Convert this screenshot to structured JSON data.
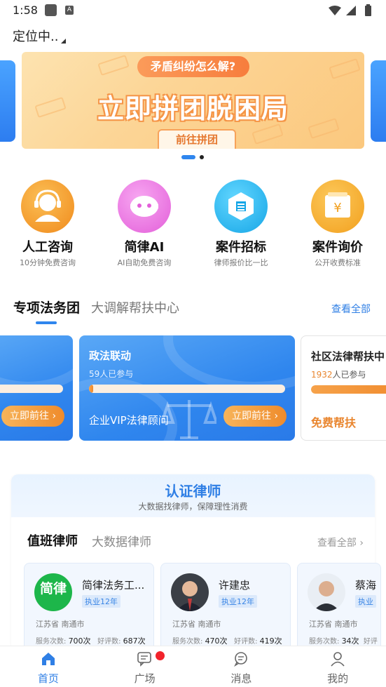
{
  "status": {
    "time": "1:58",
    "a_icon": "A"
  },
  "location": {
    "label": "定位中.."
  },
  "banner": {
    "subtitle": "矛盾纠纷怎么解?",
    "headline": "立即拼团脱困局",
    "cta": "前往拼团",
    "accent": "#f59547"
  },
  "quick_actions": [
    {
      "title": "人工咨询",
      "subtitle": "10分钟免费咨询",
      "icon": "headset-icon",
      "color": "#f39a2b"
    },
    {
      "title": "简律AI",
      "subtitle": "AI自助免费咨询",
      "icon": "ai-robot-icon",
      "color": "#ec6fe0"
    },
    {
      "title": "案件招标",
      "subtitle": "律师报价比一比",
      "icon": "cube-icon",
      "color": "#24b8ee"
    },
    {
      "title": "案件询价",
      "subtitle": "公开收费标准",
      "icon": "yuan-box-icon",
      "color": "#f5a92e"
    }
  ],
  "section": {
    "tab_active": "专项法务团",
    "tab_inactive": "大调解帮扶中心",
    "view_all": "查看全部"
  },
  "group_cards": [
    {
      "go": "立即前往",
      "progress": 1.0
    },
    {
      "title": "政法联动",
      "count": "59人已参与",
      "progress": 0.02,
      "go": "立即前往",
      "footer": "企业VIP法律顾问"
    },
    {
      "title": "社区法律帮扶中",
      "count_num": "1932",
      "count_suffix": "人已参与",
      "footer": "免费帮扶",
      "progress": 1.0
    }
  ],
  "cert": {
    "title": "认证律师",
    "subtitle": "大数据找律师，保障理性消费",
    "tab_active": "值班律师",
    "tab_inactive": "大数据律师",
    "view_all": "查看全部"
  },
  "lawyers": [
    {
      "name": "简律法务工...",
      "years": "执业12年",
      "area": "江苏省  南通市",
      "svc_label": "服务次数:",
      "svc": "700次",
      "rev_label": "好评数:",
      "rev": "687次",
      "logo_text": "简律"
    },
    {
      "name": "许建忠",
      "years": "执业12年",
      "area": "江苏省  南通市",
      "svc_label": "服务次数:",
      "svc": "470次",
      "rev_label": "好评数:",
      "rev": "419次"
    },
    {
      "name": "蔡海",
      "years": "执业",
      "area": "江苏省  南通市",
      "svc_label": "服务次数:",
      "svc": "34次",
      "rev_label": "好评",
      "rev": ""
    }
  ],
  "nav": [
    {
      "label": "首页",
      "icon": "home-icon"
    },
    {
      "label": "广场",
      "icon": "chat-square-icon"
    },
    {
      "label": "消息",
      "icon": "message-icon"
    },
    {
      "label": "我的",
      "icon": "user-icon"
    }
  ]
}
